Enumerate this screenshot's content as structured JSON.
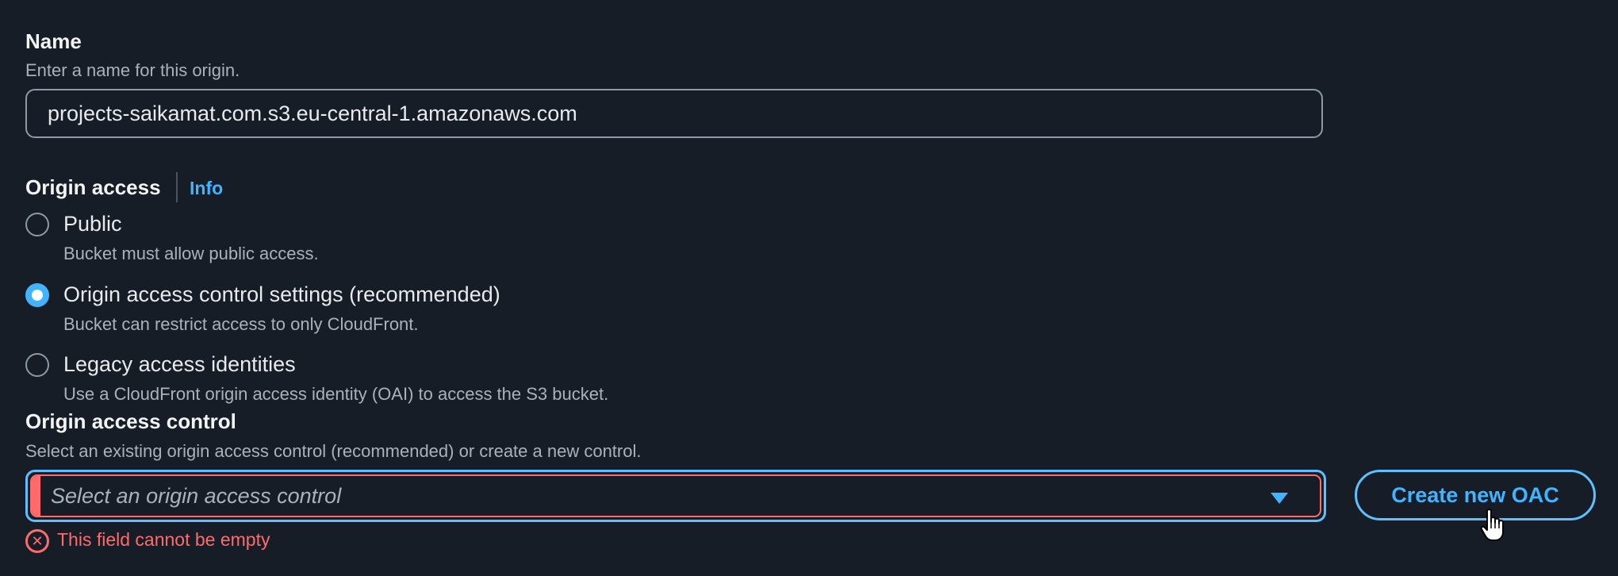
{
  "name_field": {
    "label": "Name",
    "description": "Enter a name for this origin.",
    "value": "projects-saikamat.com.s3.eu-central-1.amazonaws.com"
  },
  "origin_access": {
    "label": "Origin access",
    "info_link": "Info",
    "options": [
      {
        "label": "Public",
        "description": "Bucket must allow public access.",
        "selected": false
      },
      {
        "label": "Origin access control settings (recommended)",
        "description": "Bucket can restrict access to only CloudFront.",
        "selected": true
      },
      {
        "label": "Legacy access identities",
        "description": "Use a CloudFront origin access identity (OAI) to access the S3 bucket.",
        "selected": false
      }
    ]
  },
  "origin_access_control": {
    "label": "Origin access control",
    "description": "Select an existing origin access control (recommended) or create a new control.",
    "placeholder": "Select an origin access control",
    "create_button": "Create new OAC",
    "error": "This field cannot be empty"
  },
  "colors": {
    "background": "#161d26",
    "accent": "#42b4ff",
    "error": "#ff6b6b",
    "text_primary": "#f2f3f3",
    "text_secondary": "#a9b2bc"
  }
}
